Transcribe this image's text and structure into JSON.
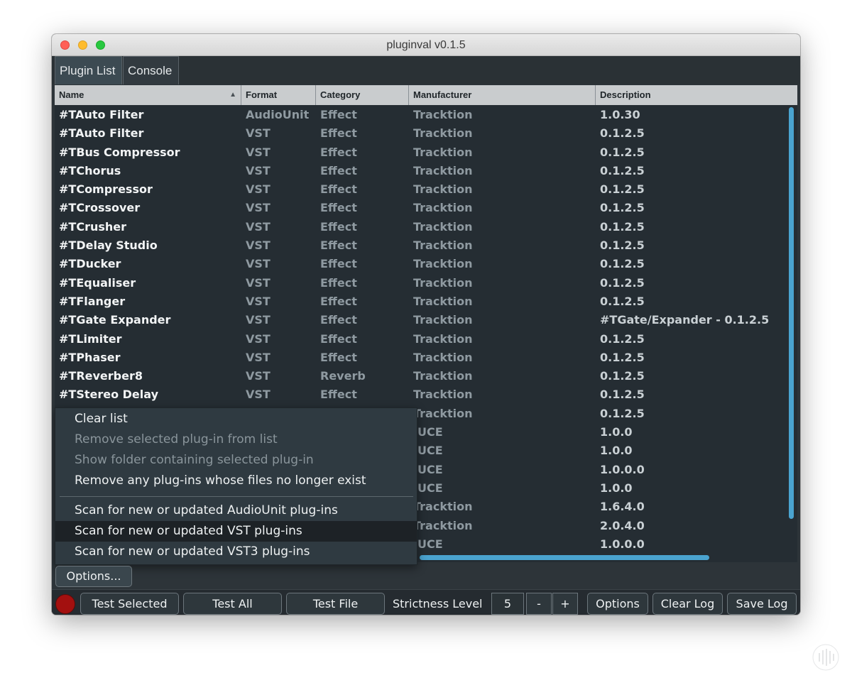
{
  "window": {
    "title": "pluginval v0.1.5"
  },
  "tabs": [
    {
      "label": "Plugin List"
    },
    {
      "label": "Console"
    }
  ],
  "table": {
    "columns": [
      "Name",
      "Format",
      "Category",
      "Manufacturer",
      "Description"
    ],
    "sort_column": "Name",
    "sort_direction": "ascending",
    "rows": [
      {
        "name": "#TAuto Filter",
        "format": "AudioUnit",
        "category": "Effect",
        "manufacturer": "Tracktion",
        "description": "1.0.30"
      },
      {
        "name": "#TAuto Filter",
        "format": "VST",
        "category": "Effect",
        "manufacturer": "Tracktion",
        "description": "0.1.2.5"
      },
      {
        "name": "#TBus Compressor",
        "format": "VST",
        "category": "Effect",
        "manufacturer": "Tracktion",
        "description": "0.1.2.5"
      },
      {
        "name": "#TChorus",
        "format": "VST",
        "category": "Effect",
        "manufacturer": "Tracktion",
        "description": "0.1.2.5"
      },
      {
        "name": "#TCompressor",
        "format": "VST",
        "category": "Effect",
        "manufacturer": "Tracktion",
        "description": "0.1.2.5"
      },
      {
        "name": "#TCrossover",
        "format": "VST",
        "category": "Effect",
        "manufacturer": "Tracktion",
        "description": "0.1.2.5"
      },
      {
        "name": "#TCrusher",
        "format": "VST",
        "category": "Effect",
        "manufacturer": "Tracktion",
        "description": "0.1.2.5"
      },
      {
        "name": "#TDelay Studio",
        "format": "VST",
        "category": "Effect",
        "manufacturer": "Tracktion",
        "description": "0.1.2.5"
      },
      {
        "name": "#TDucker",
        "format": "VST",
        "category": "Effect",
        "manufacturer": "Tracktion",
        "description": "0.1.2.5"
      },
      {
        "name": "#TEqualiser",
        "format": "VST",
        "category": "Effect",
        "manufacturer": "Tracktion",
        "description": "0.1.2.5"
      },
      {
        "name": "#TFlanger",
        "format": "VST",
        "category": "Effect",
        "manufacturer": "Tracktion",
        "description": "0.1.2.5"
      },
      {
        "name": "#TGate Expander",
        "format": "VST",
        "category": "Effect",
        "manufacturer": "Tracktion",
        "description": "#TGate/Expander - 0.1.2.5"
      },
      {
        "name": "#TLimiter",
        "format": "VST",
        "category": "Effect",
        "manufacturer": "Tracktion",
        "description": "0.1.2.5"
      },
      {
        "name": "#TPhaser",
        "format": "VST",
        "category": "Effect",
        "manufacturer": "Tracktion",
        "description": "0.1.2.5"
      },
      {
        "name": "#TReverber8",
        "format": "VST",
        "category": "Reverb",
        "manufacturer": "Tracktion",
        "description": "0.1.2.5"
      },
      {
        "name": "#TStereo Delay",
        "format": "VST",
        "category": "Effect",
        "manufacturer": "Tracktion",
        "description": "0.1.2.5"
      },
      {
        "name": "",
        "format": "",
        "category": "",
        "manufacturer": "Tracktion",
        "description": "0.1.2.5"
      },
      {
        "name": "",
        "format": "",
        "category": "",
        "manufacturer": "JUCE",
        "description": "1.0.0"
      },
      {
        "name": "",
        "format": "",
        "category": "",
        "manufacturer": "JUCE",
        "description": "1.0.0"
      },
      {
        "name": "",
        "format": "",
        "category": "",
        "manufacturer": "JUCE",
        "description": "1.0.0.0"
      },
      {
        "name": "",
        "format": "",
        "category": "",
        "manufacturer": "JUCE",
        "description": "1.0.0"
      },
      {
        "name": "",
        "format": "",
        "category": "",
        "manufacturer": "Tracktion",
        "description": "1.6.4.0"
      },
      {
        "name": "",
        "format": "",
        "category": "",
        "manufacturer": "Tracktion",
        "description": "2.0.4.0"
      },
      {
        "name": "",
        "format": "",
        "category": "",
        "manufacturer": "JUCE",
        "description": "1.0.0.0"
      }
    ]
  },
  "menu": {
    "items": [
      {
        "label": "Clear list",
        "enabled": true
      },
      {
        "label": "Remove selected plug-in from list",
        "enabled": false
      },
      {
        "label": "Show folder containing selected plug-in",
        "enabled": false
      },
      {
        "label": "Remove any plug-ins whose files no longer exist",
        "enabled": true
      },
      {
        "label": "Scan for new or updated AudioUnit plug-ins",
        "enabled": true
      },
      {
        "label": "Scan for new or updated VST plug-ins",
        "enabled": true,
        "highlighted": true
      },
      {
        "label": "Scan for new or updated VST3 plug-ins",
        "enabled": true
      }
    ]
  },
  "options_button": "Options...",
  "toolbar": {
    "test_selected": "Test Selected",
    "test_all": "Test All",
    "test_file": "Test File",
    "strictness_label": "Strictness Level",
    "strictness_value": "5",
    "minus": "-",
    "plus": "+",
    "options": "Options",
    "clear_log": "Clear Log",
    "save_log": "Save Log"
  },
  "colors": {
    "accent": "#4aa3cf",
    "record": "#a3100f",
    "background": "#2d3439"
  }
}
